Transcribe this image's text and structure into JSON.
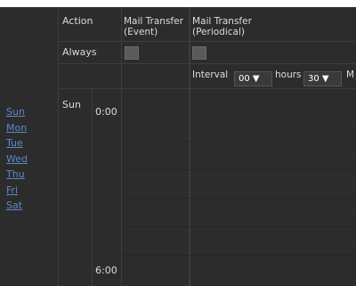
{
  "header": {
    "action": "Action",
    "col_event_line1": "Mail Transfer",
    "col_event_line2": "(Event)",
    "col_periodic_line1": "Mail Transfer",
    "col_periodic_line2": "(Periodical)"
  },
  "always_row": {
    "label": "Always"
  },
  "interval_row": {
    "interval_label": "Interval",
    "hours_value": "00 ▼",
    "hours_label": "hours",
    "minutes_value": "30 ▼",
    "minutes_label": "M"
  },
  "schedule": {
    "day_label": "Sun",
    "time_start": "0:00",
    "time_end": "6:00"
  },
  "day_links": [
    "Sun",
    "Mon",
    "Tue",
    "Wed",
    "Thu",
    "Fri",
    "Sat"
  ]
}
